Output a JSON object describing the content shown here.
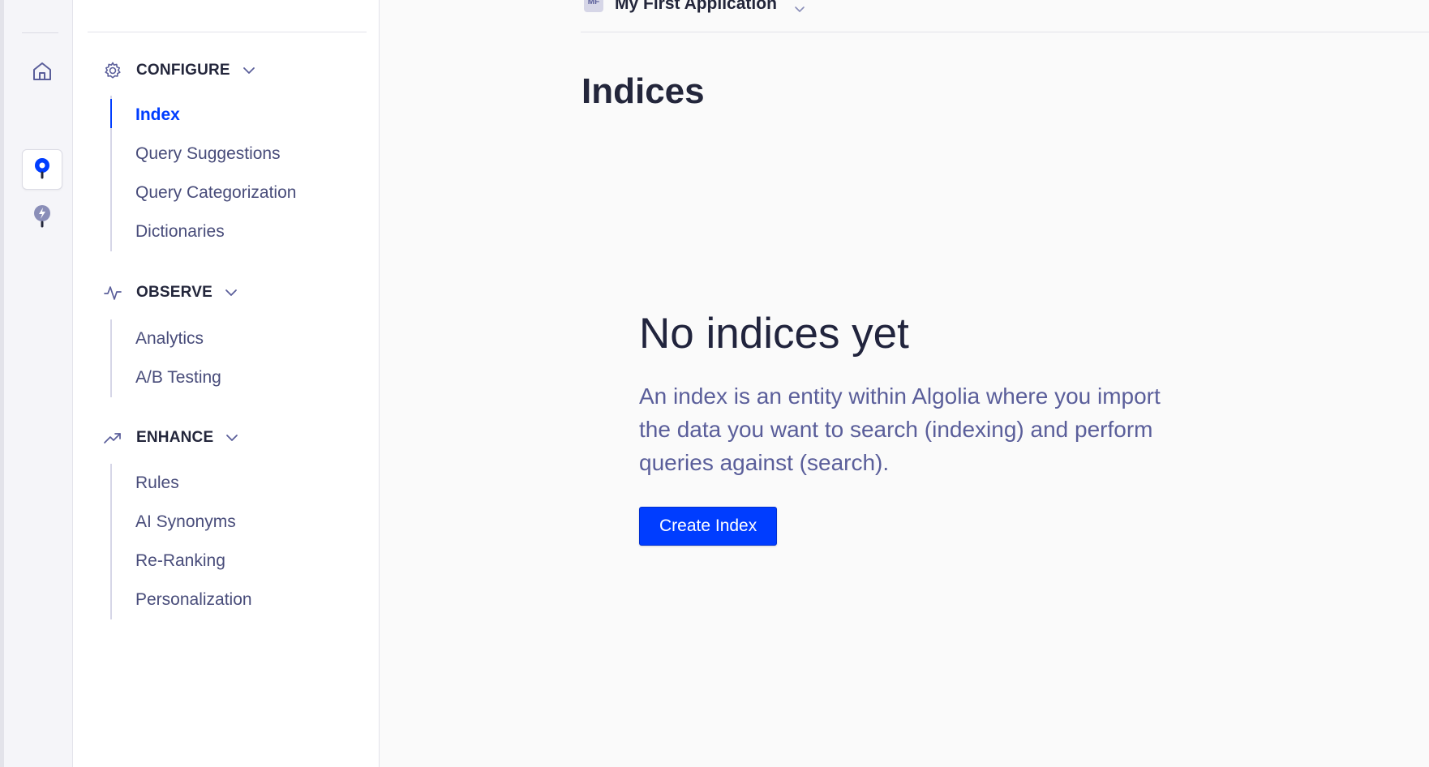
{
  "app_switcher": {
    "badge": "MF",
    "name": "My First Application"
  },
  "rail": {
    "items": [
      "logo-icon",
      "home-icon",
      "search-icon",
      "bolt-icon"
    ],
    "active": "search-icon"
  },
  "subnav": {
    "sections": [
      {
        "label": "CONFIGURE",
        "icon": "gear-icon",
        "items": [
          {
            "label": "Index",
            "active": true
          },
          {
            "label": "Query Suggestions"
          },
          {
            "label": "Query Categorization"
          },
          {
            "label": "Dictionaries"
          }
        ]
      },
      {
        "label": "OBSERVE",
        "icon": "pulse-icon",
        "items": [
          {
            "label": "Analytics"
          },
          {
            "label": "A/B Testing"
          }
        ]
      },
      {
        "label": "ENHANCE",
        "icon": "trend-up-icon",
        "items": [
          {
            "label": "Rules"
          },
          {
            "label": "AI Synonyms"
          },
          {
            "label": "Re-Ranking"
          },
          {
            "label": "Personalization"
          }
        ]
      }
    ]
  },
  "main": {
    "title": "Indices",
    "empty_state": {
      "title": "No indices yet",
      "description": "An index is an entity within Algolia where you import the data you want to search (indexing) and perform queries against (search).",
      "button_label": "Create Index"
    }
  },
  "colors": {
    "accent": "#003dff",
    "text_dark": "#23263b",
    "text_muted": "#5a5e9a"
  }
}
